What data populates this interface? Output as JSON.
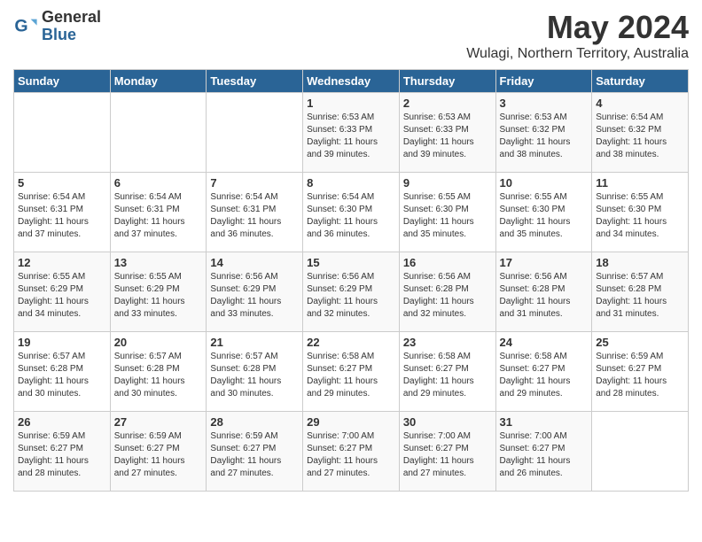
{
  "header": {
    "logo_general": "General",
    "logo_blue": "Blue",
    "month_title": "May 2024",
    "location": "Wulagi, Northern Territory, Australia"
  },
  "weekdays": [
    "Sunday",
    "Monday",
    "Tuesday",
    "Wednesday",
    "Thursday",
    "Friday",
    "Saturday"
  ],
  "weeks": [
    [
      {
        "day": "",
        "info": ""
      },
      {
        "day": "",
        "info": ""
      },
      {
        "day": "",
        "info": ""
      },
      {
        "day": "1",
        "info": "Sunrise: 6:53 AM\nSunset: 6:33 PM\nDaylight: 11 hours\nand 39 minutes."
      },
      {
        "day": "2",
        "info": "Sunrise: 6:53 AM\nSunset: 6:33 PM\nDaylight: 11 hours\nand 39 minutes."
      },
      {
        "day": "3",
        "info": "Sunrise: 6:53 AM\nSunset: 6:32 PM\nDaylight: 11 hours\nand 38 minutes."
      },
      {
        "day": "4",
        "info": "Sunrise: 6:54 AM\nSunset: 6:32 PM\nDaylight: 11 hours\nand 38 minutes."
      }
    ],
    [
      {
        "day": "5",
        "info": "Sunrise: 6:54 AM\nSunset: 6:31 PM\nDaylight: 11 hours\nand 37 minutes."
      },
      {
        "day": "6",
        "info": "Sunrise: 6:54 AM\nSunset: 6:31 PM\nDaylight: 11 hours\nand 37 minutes."
      },
      {
        "day": "7",
        "info": "Sunrise: 6:54 AM\nSunset: 6:31 PM\nDaylight: 11 hours\nand 36 minutes."
      },
      {
        "day": "8",
        "info": "Sunrise: 6:54 AM\nSunset: 6:30 PM\nDaylight: 11 hours\nand 36 minutes."
      },
      {
        "day": "9",
        "info": "Sunrise: 6:55 AM\nSunset: 6:30 PM\nDaylight: 11 hours\nand 35 minutes."
      },
      {
        "day": "10",
        "info": "Sunrise: 6:55 AM\nSunset: 6:30 PM\nDaylight: 11 hours\nand 35 minutes."
      },
      {
        "day": "11",
        "info": "Sunrise: 6:55 AM\nSunset: 6:30 PM\nDaylight: 11 hours\nand 34 minutes."
      }
    ],
    [
      {
        "day": "12",
        "info": "Sunrise: 6:55 AM\nSunset: 6:29 PM\nDaylight: 11 hours\nand 34 minutes."
      },
      {
        "day": "13",
        "info": "Sunrise: 6:55 AM\nSunset: 6:29 PM\nDaylight: 11 hours\nand 33 minutes."
      },
      {
        "day": "14",
        "info": "Sunrise: 6:56 AM\nSunset: 6:29 PM\nDaylight: 11 hours\nand 33 minutes."
      },
      {
        "day": "15",
        "info": "Sunrise: 6:56 AM\nSunset: 6:29 PM\nDaylight: 11 hours\nand 32 minutes."
      },
      {
        "day": "16",
        "info": "Sunrise: 6:56 AM\nSunset: 6:28 PM\nDaylight: 11 hours\nand 32 minutes."
      },
      {
        "day": "17",
        "info": "Sunrise: 6:56 AM\nSunset: 6:28 PM\nDaylight: 11 hours\nand 31 minutes."
      },
      {
        "day": "18",
        "info": "Sunrise: 6:57 AM\nSunset: 6:28 PM\nDaylight: 11 hours\nand 31 minutes."
      }
    ],
    [
      {
        "day": "19",
        "info": "Sunrise: 6:57 AM\nSunset: 6:28 PM\nDaylight: 11 hours\nand 30 minutes."
      },
      {
        "day": "20",
        "info": "Sunrise: 6:57 AM\nSunset: 6:28 PM\nDaylight: 11 hours\nand 30 minutes."
      },
      {
        "day": "21",
        "info": "Sunrise: 6:57 AM\nSunset: 6:28 PM\nDaylight: 11 hours\nand 30 minutes."
      },
      {
        "day": "22",
        "info": "Sunrise: 6:58 AM\nSunset: 6:27 PM\nDaylight: 11 hours\nand 29 minutes."
      },
      {
        "day": "23",
        "info": "Sunrise: 6:58 AM\nSunset: 6:27 PM\nDaylight: 11 hours\nand 29 minutes."
      },
      {
        "day": "24",
        "info": "Sunrise: 6:58 AM\nSunset: 6:27 PM\nDaylight: 11 hours\nand 29 minutes."
      },
      {
        "day": "25",
        "info": "Sunrise: 6:59 AM\nSunset: 6:27 PM\nDaylight: 11 hours\nand 28 minutes."
      }
    ],
    [
      {
        "day": "26",
        "info": "Sunrise: 6:59 AM\nSunset: 6:27 PM\nDaylight: 11 hours\nand 28 minutes."
      },
      {
        "day": "27",
        "info": "Sunrise: 6:59 AM\nSunset: 6:27 PM\nDaylight: 11 hours\nand 27 minutes."
      },
      {
        "day": "28",
        "info": "Sunrise: 6:59 AM\nSunset: 6:27 PM\nDaylight: 11 hours\nand 27 minutes."
      },
      {
        "day": "29",
        "info": "Sunrise: 7:00 AM\nSunset: 6:27 PM\nDaylight: 11 hours\nand 27 minutes."
      },
      {
        "day": "30",
        "info": "Sunrise: 7:00 AM\nSunset: 6:27 PM\nDaylight: 11 hours\nand 27 minutes."
      },
      {
        "day": "31",
        "info": "Sunrise: 7:00 AM\nSunset: 6:27 PM\nDaylight: 11 hours\nand 26 minutes."
      },
      {
        "day": "",
        "info": ""
      }
    ]
  ]
}
